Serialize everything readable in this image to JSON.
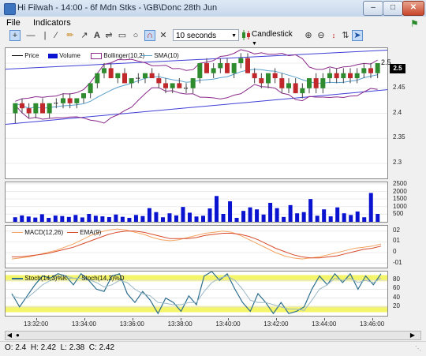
{
  "window": {
    "title": "Hi Filwah - 14:00 - 6f Mdn Stks - \\GB\\Donc 28th Jun"
  },
  "menu": {
    "items": [
      "File",
      "Indicators"
    ]
  },
  "toolbar": {
    "interval": "10 seconds",
    "chart_type": "Candlestick",
    "tools": [
      "crosshair-icon",
      "horizontal-line-icon",
      "vertical-line-icon",
      "trend-line-icon",
      "pencil-icon",
      "arrow-icon",
      "text-icon",
      "fibonacci-icon",
      "rectangle-icon",
      "ellipse-icon",
      "magnet-icon",
      "delete-icon"
    ],
    "zoom_tools": [
      "zoom-in-icon",
      "zoom-out-icon",
      "scale-icon",
      "scroll-right-icon"
    ]
  },
  "chart_data": [
    {
      "type": "candlestick",
      "legend": [
        "Price",
        "Volume",
        "Bollinger(10,2)",
        "SMA(10)"
      ],
      "y_ticks": [
        "2.5",
        "2.45",
        "2.4",
        "2.35",
        "2.3"
      ],
      "ylim": [
        2.27,
        2.53
      ],
      "last_price": "2.5",
      "price_label": "2.5",
      "candles": [
        [
          2.4,
          2.42,
          2.38,
          2.42
        ],
        [
          2.42,
          2.43,
          2.4,
          2.41
        ],
        [
          2.41,
          2.42,
          2.39,
          2.4
        ],
        [
          2.4,
          2.42,
          2.39,
          2.42
        ],
        [
          2.42,
          2.43,
          2.4,
          2.4
        ],
        [
          2.4,
          2.42,
          2.39,
          2.42
        ],
        [
          2.42,
          2.43,
          2.41,
          2.42
        ],
        [
          2.42,
          2.44,
          2.41,
          2.43
        ],
        [
          2.43,
          2.44,
          2.41,
          2.42
        ],
        [
          2.42,
          2.43,
          2.41,
          2.43
        ],
        [
          2.43,
          2.44,
          2.42,
          2.44
        ],
        [
          2.44,
          2.46,
          2.43,
          2.46
        ],
        [
          2.46,
          2.48,
          2.45,
          2.48
        ],
        [
          2.48,
          2.5,
          2.47,
          2.49
        ],
        [
          2.49,
          2.5,
          2.47,
          2.47
        ],
        [
          2.47,
          2.48,
          2.46,
          2.48
        ],
        [
          2.48,
          2.49,
          2.46,
          2.46
        ],
        [
          2.46,
          2.47,
          2.45,
          2.47
        ],
        [
          2.47,
          2.48,
          2.46,
          2.47
        ],
        [
          2.47,
          2.48,
          2.46,
          2.48
        ],
        [
          2.48,
          2.49,
          2.47,
          2.47
        ],
        [
          2.47,
          2.48,
          2.45,
          2.46
        ],
        [
          2.46,
          2.47,
          2.44,
          2.45
        ],
        [
          2.45,
          2.46,
          2.44,
          2.46
        ],
        [
          2.46,
          2.47,
          2.45,
          2.45
        ],
        [
          2.45,
          2.46,
          2.44,
          2.45
        ],
        [
          2.45,
          2.47,
          2.44,
          2.47
        ],
        [
          2.47,
          2.5,
          2.46,
          2.5
        ],
        [
          2.5,
          2.51,
          2.48,
          2.48
        ],
        [
          2.48,
          2.5,
          2.47,
          2.49
        ],
        [
          2.49,
          2.51,
          2.48,
          2.5
        ],
        [
          2.5,
          2.51,
          2.48,
          2.48
        ],
        [
          2.48,
          2.5,
          2.47,
          2.5
        ],
        [
          2.5,
          2.52,
          2.49,
          2.51
        ],
        [
          2.51,
          2.52,
          2.48,
          2.48
        ],
        [
          2.48,
          2.49,
          2.46,
          2.47
        ],
        [
          2.47,
          2.48,
          2.45,
          2.46
        ],
        [
          2.46,
          2.48,
          2.45,
          2.48
        ],
        [
          2.48,
          2.49,
          2.46,
          2.47
        ],
        [
          2.47,
          2.48,
          2.44,
          2.45
        ],
        [
          2.45,
          2.47,
          2.44,
          2.46
        ],
        [
          2.46,
          2.47,
          2.44,
          2.44
        ],
        [
          2.44,
          2.46,
          2.43,
          2.45
        ],
        [
          2.45,
          2.47,
          2.44,
          2.47
        ],
        [
          2.47,
          2.48,
          2.44,
          2.45
        ],
        [
          2.45,
          2.48,
          2.44,
          2.47
        ],
        [
          2.47,
          2.49,
          2.46,
          2.48
        ],
        [
          2.48,
          2.49,
          2.46,
          2.47
        ],
        [
          2.47,
          2.49,
          2.46,
          2.48
        ],
        [
          2.48,
          2.49,
          2.46,
          2.47
        ],
        [
          2.47,
          2.49,
          2.46,
          2.48
        ],
        [
          2.48,
          2.5,
          2.47,
          2.49
        ],
        [
          2.49,
          2.5,
          2.47,
          2.48
        ],
        [
          2.48,
          2.5,
          2.47,
          2.5
        ]
      ]
    },
    {
      "type": "bar",
      "name": "Volume",
      "y_ticks": [
        "2500",
        "2000",
        "1500",
        "1000",
        "500"
      ],
      "ylim": [
        0,
        2600
      ],
      "values": [
        300,
        420,
        350,
        280,
        500,
        260,
        410,
        380,
        320,
        450,
        290,
        520,
        400,
        360,
        310,
        480,
        330,
        260,
        450,
        380,
        900,
        640,
        300,
        560,
        420,
        980,
        600,
        350,
        400,
        880,
        1700,
        520,
        1350,
        260,
        720,
        950,
        820,
        480,
        1250,
        900,
        320,
        1100,
        560,
        640,
        1500,
        400,
        820,
        360,
        950,
        560,
        450,
        680,
        300,
        1900,
        520
      ]
    },
    {
      "type": "line",
      "legend": [
        "MACD(12,26)",
        "EMA(9)"
      ],
      "y_ticks": [
        "02",
        "01",
        "0",
        "-01"
      ],
      "ylim": [
        -0.014,
        0.025
      ],
      "series": [
        {
          "name": "MACD(12,26)",
          "values": [
            -0.006,
            -0.005,
            -0.004,
            -0.002,
            0.0,
            0.002,
            0.005,
            0.008,
            0.012,
            0.016,
            0.019,
            0.021,
            0.022,
            0.021,
            0.019,
            0.017,
            0.014,
            0.012,
            0.011,
            0.012,
            0.014,
            0.016,
            0.018,
            0.019,
            0.02,
            0.019,
            0.016,
            0.012,
            0.008,
            0.004,
            0.0,
            -0.003,
            -0.005,
            -0.006,
            -0.005,
            -0.004,
            -0.002,
            0.0,
            0.002,
            0.004,
            0.005,
            0.006,
            0.008
          ]
        },
        {
          "name": "EMA(9)",
          "values": [
            -0.004,
            -0.004,
            -0.003,
            -0.002,
            -0.001,
            0.001,
            0.003,
            0.005,
            0.008,
            0.011,
            0.014,
            0.017,
            0.019,
            0.02,
            0.02,
            0.019,
            0.017,
            0.015,
            0.013,
            0.013,
            0.013,
            0.014,
            0.016,
            0.017,
            0.018,
            0.018,
            0.017,
            0.015,
            0.012,
            0.008,
            0.004,
            0.001,
            -0.002,
            -0.004,
            -0.005,
            -0.005,
            -0.004,
            -0.003,
            -0.001,
            0.001,
            0.003,
            0.004,
            0.006
          ]
        }
      ]
    },
    {
      "type": "line",
      "legend": [
        "Stoch(14,3)%K",
        "Stoch(14,3)%D"
      ],
      "y_ticks": [
        "80",
        "60",
        "40",
        "20"
      ],
      "ylim": [
        0,
        100
      ],
      "series": [
        {
          "name": "Stoch(14,3)%K",
          "values": [
            50,
            20,
            45,
            70,
            90,
            85,
            95,
            90,
            70,
            95,
            80,
            60,
            55,
            90,
            95,
            50,
            30,
            55,
            35,
            5,
            40,
            30,
            10,
            45,
            25,
            90,
            100,
            80,
            95,
            60,
            30,
            10,
            50,
            30,
            5,
            30,
            5,
            10,
            20,
            60,
            90,
            70,
            95,
            75,
            95,
            60,
            90,
            70,
            95
          ]
        },
        {
          "name": "Stoch(14,3)%D",
          "values": [
            45,
            40,
            40,
            55,
            70,
            80,
            88,
            90,
            85,
            85,
            82,
            75,
            65,
            70,
            80,
            75,
            60,
            50,
            45,
            30,
            28,
            25,
            25,
            30,
            30,
            55,
            75,
            85,
            90,
            80,
            60,
            35,
            30,
            30,
            25,
            20,
            15,
            15,
            12,
            35,
            60,
            70,
            85,
            80,
            85,
            75,
            80,
            75,
            85
          ]
        }
      ]
    }
  ],
  "x_axis": {
    "labels": [
      "13:32:00",
      "13:34:00",
      "13:36:00",
      "13:38:00",
      "13:40:00",
      "13:42:00",
      "13:44:00",
      "13:46:00"
    ]
  },
  "status": {
    "o_label": "O:",
    "o": "2.4",
    "h_label": "H:",
    "h": "2.42",
    "l_label": "L:",
    "l": "2.38",
    "c_label": "C:",
    "c": "2.42"
  },
  "colors": {
    "bull": "#2e8b2e",
    "bear": "#c0282c",
    "bollinger": "#8b2a8b",
    "sma": "#5aa0cc",
    "trend": "#3f3fd8",
    "volume": "#0a14d0",
    "macd": "#f4a460",
    "ema": "#d84a2a",
    "stoch_band": "#f5f56a",
    "stochK": "#2e6e8e",
    "stochD": "#9ab8c8"
  }
}
